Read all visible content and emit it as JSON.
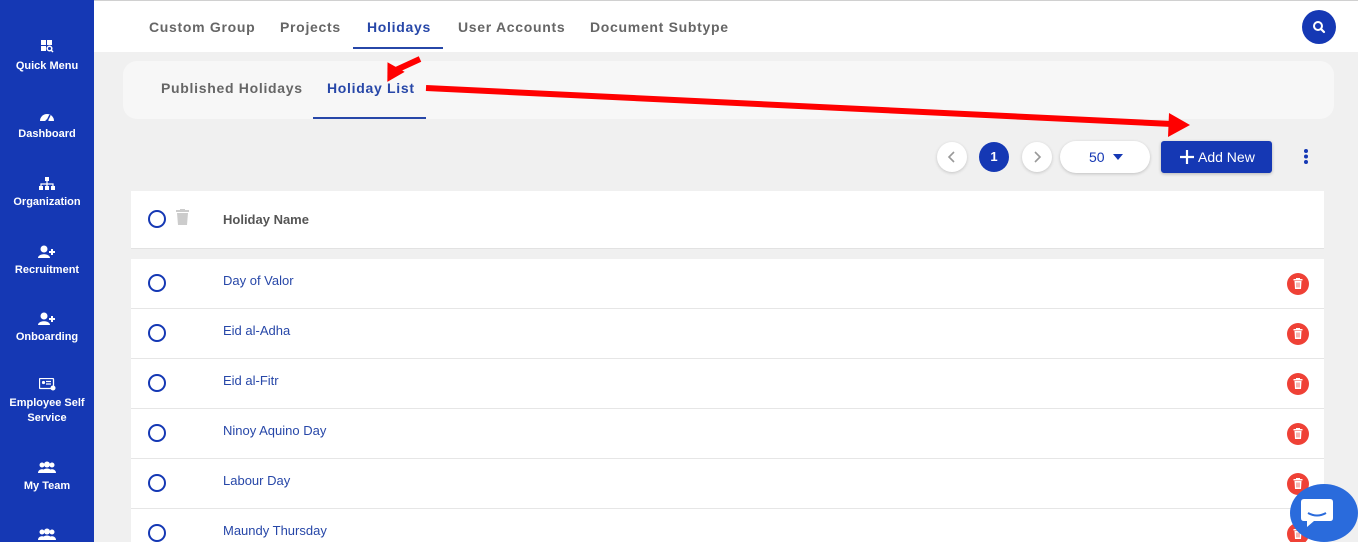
{
  "sidebar": {
    "items": [
      {
        "label": "Quick Menu",
        "icon": "grid-search-icon"
      },
      {
        "label": "Dashboard",
        "icon": "gauge-icon"
      },
      {
        "label": "Organization",
        "icon": "org-chart-icon"
      },
      {
        "label": "Recruitment",
        "icon": "user-plus-icon"
      },
      {
        "label": "Onboarding",
        "icon": "user-plus-icon"
      },
      {
        "label": "Employee Self Service",
        "icon": "id-card-icon"
      },
      {
        "label": "My Team",
        "icon": "users-icon"
      },
      {
        "label": "",
        "icon": "users-icon"
      }
    ]
  },
  "top_tabs": [
    {
      "label": "Custom Group"
    },
    {
      "label": "Projects"
    },
    {
      "label": "Holidays",
      "active": true
    },
    {
      "label": "User Accounts"
    },
    {
      "label": "Document Subtype"
    }
  ],
  "sub_tabs": [
    {
      "label": "Published Holidays"
    },
    {
      "label": "Holiday List",
      "active": true
    }
  ],
  "pager": {
    "current_page": "1",
    "page_size": "50"
  },
  "add_button": {
    "label": "Add New"
  },
  "table": {
    "header": "Holiday Name",
    "rows": [
      {
        "name": "Day of Valor"
      },
      {
        "name": "Eid al-Adha"
      },
      {
        "name": "Eid al-Fitr"
      },
      {
        "name": "Ninoy Aquino Day"
      },
      {
        "name": "Labour Day"
      },
      {
        "name": "Maundy Thursday"
      }
    ]
  },
  "colors": {
    "brand": "#1538b4",
    "link": "#2747a8",
    "delete": "#ef4136",
    "annotation_arrow": "#ff0000"
  }
}
